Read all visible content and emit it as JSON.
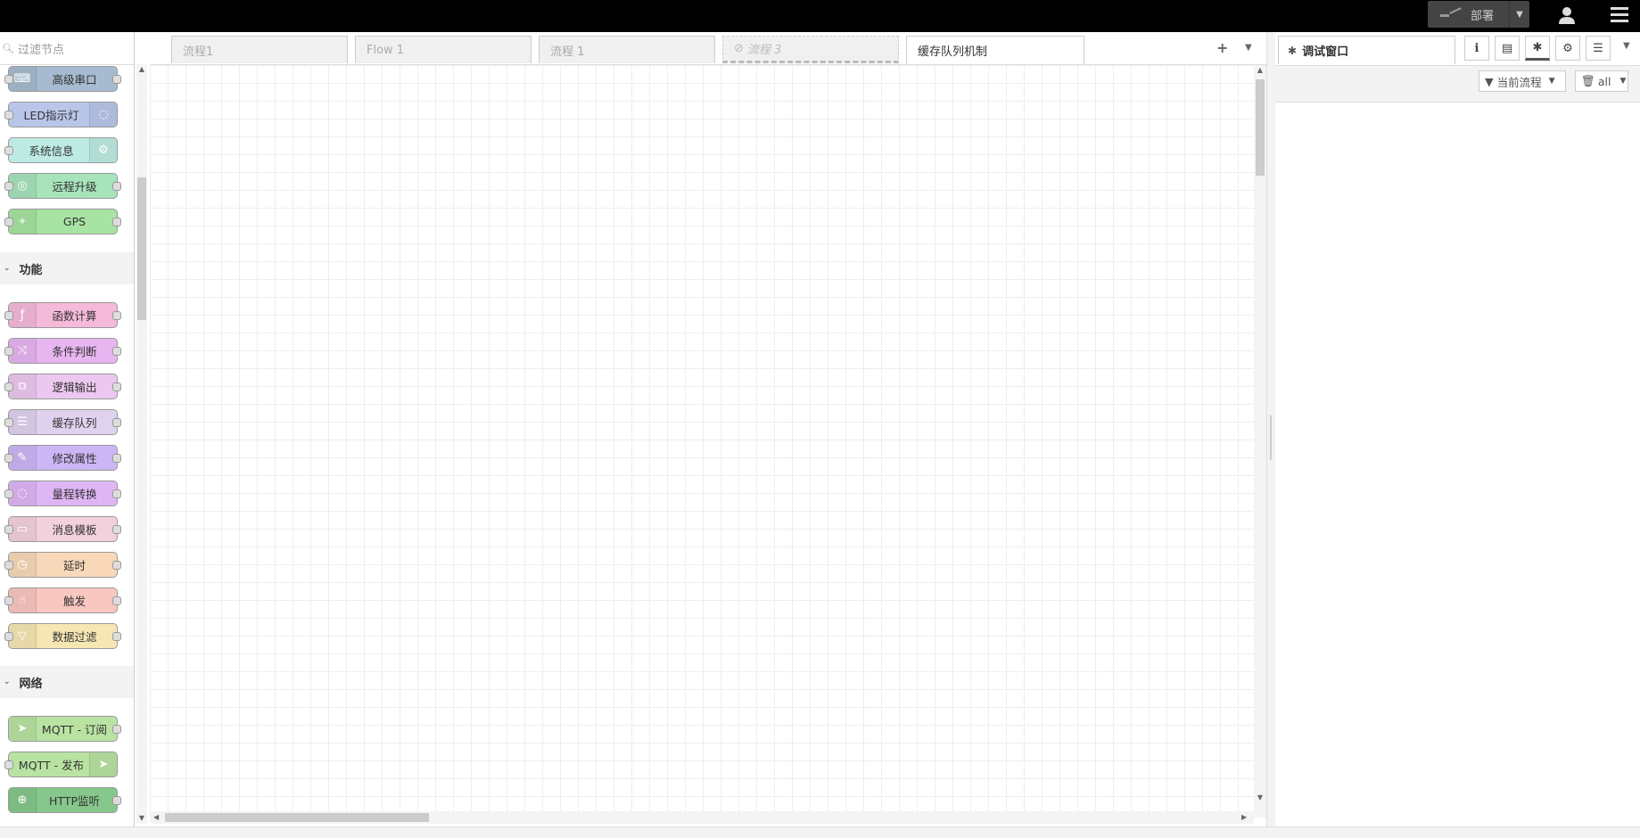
{
  "header": {
    "deploy_label": "部署"
  },
  "palette": {
    "filter_placeholder": "过滤节点",
    "nodes_top": [
      {
        "label": "高级串口",
        "color": "#a6bbcf",
        "icon": "keyboard-icon"
      },
      {
        "label": "LED指示灯",
        "color": "#b9c6ea",
        "icon": "lightbulb-icon"
      },
      {
        "label": "系统信息",
        "color": "#bdebe3",
        "icon": "gear-icon"
      },
      {
        "label": "远程升级",
        "color": "#a7e3bb",
        "icon": "upgrade-icon"
      },
      {
        "label": "GPS",
        "color": "#a7e3a2",
        "icon": "map-pin-icon"
      }
    ],
    "category_function": "功能",
    "nodes_function": [
      {
        "label": "函数计算",
        "color": "#f5b9d9",
        "icon": "function-icon"
      },
      {
        "label": "条件判断",
        "color": "#e7b5f0",
        "icon": "switch-icon"
      },
      {
        "label": "逻辑输出",
        "color": "#ecc8f0",
        "icon": "sitemap-icon"
      },
      {
        "label": "缓存队列",
        "color": "#dfd2ef",
        "icon": "list-icon"
      },
      {
        "label": "修改属性",
        "color": "#cdb6f5",
        "icon": "pencil-icon"
      },
      {
        "label": "量程转换",
        "color": "#dfb6f4",
        "icon": "range-icon"
      },
      {
        "label": "消息模板",
        "color": "#f2d1dc",
        "icon": "comment-icon"
      },
      {
        "label": "延时",
        "color": "#f8d8b8",
        "icon": "clock-icon"
      },
      {
        "label": "触发",
        "color": "#f9c6c0",
        "icon": "hand-icon"
      },
      {
        "label": "数据过滤",
        "color": "#f6e6b3",
        "icon": "filter-icon"
      }
    ],
    "category_network": "网络",
    "nodes_network": [
      {
        "label": "MQTT - 订阅",
        "color": "#b9e3a2",
        "icon": "send-icon"
      },
      {
        "label": "MQTT - 发布",
        "color": "#b9e3a2",
        "icon": "send-icon"
      },
      {
        "label": "HTTP监听",
        "color": "#86c78b",
        "icon": "globe-icon"
      }
    ]
  },
  "tabs": [
    {
      "label": "流程1"
    },
    {
      "label": "Flow 1"
    },
    {
      "label": "流程 1"
    },
    {
      "label": "流程 3"
    },
    {
      "label": "缓存队列机制"
    }
  ],
  "sidebar": {
    "tab_label": "调试窗口",
    "filter_label": "当前流程",
    "clear_label": "all"
  }
}
